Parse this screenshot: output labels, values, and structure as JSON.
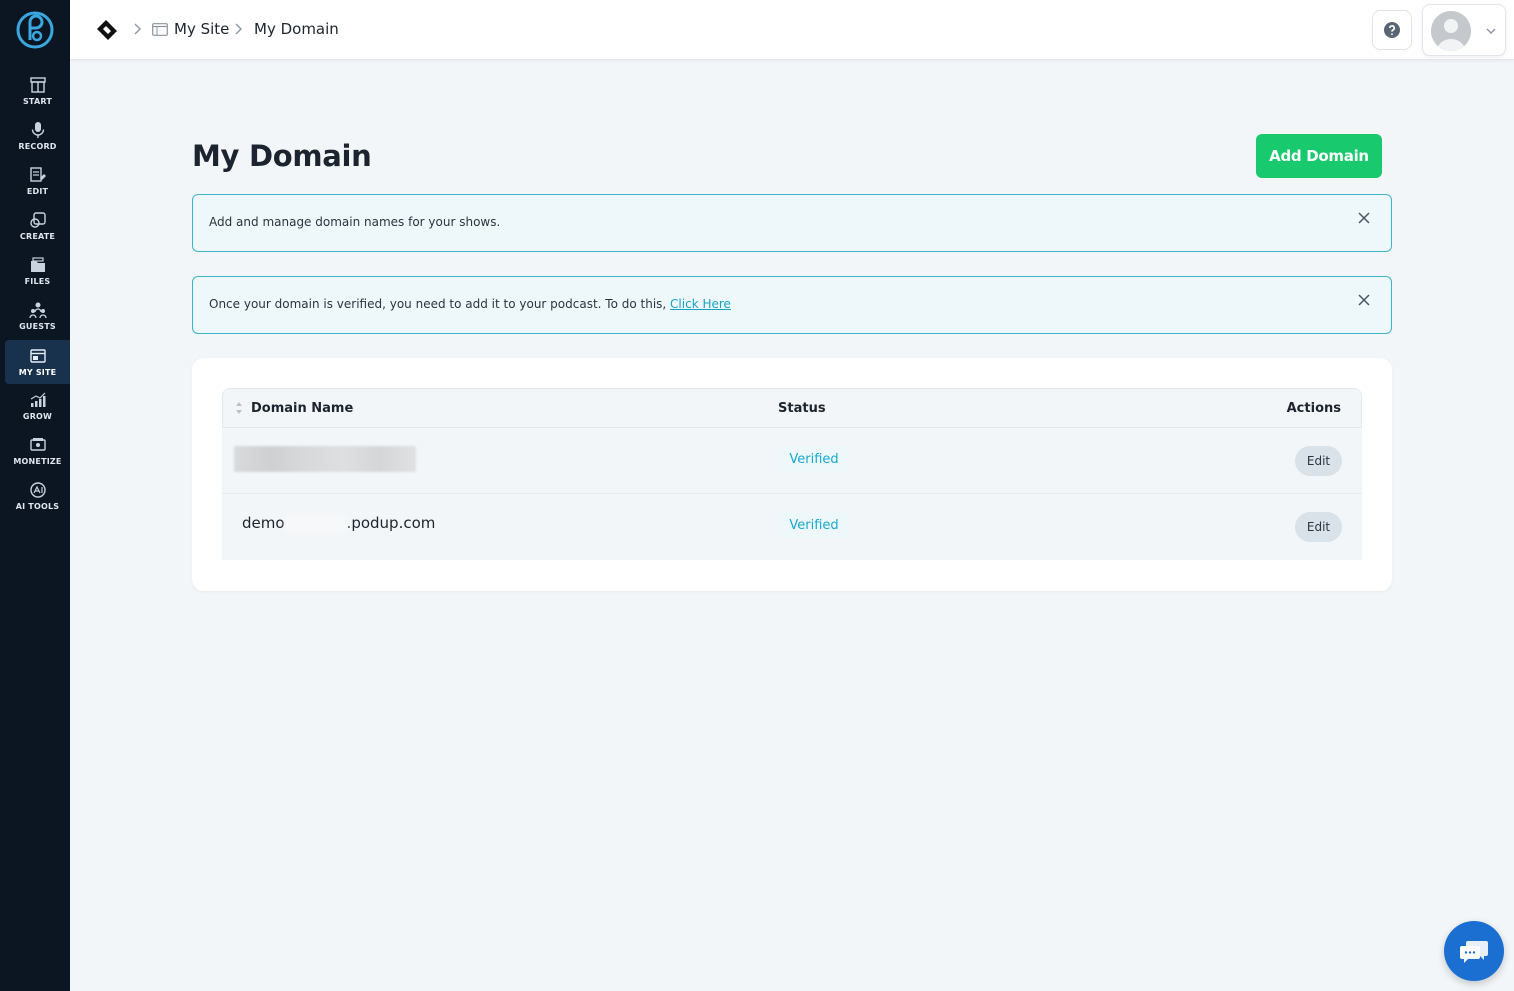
{
  "sidebar": {
    "items": [
      {
        "label": "START",
        "icon": "start-icon"
      },
      {
        "label": "RECORD",
        "icon": "microphone-icon"
      },
      {
        "label": "EDIT",
        "icon": "edit-icon"
      },
      {
        "label": "CREATE",
        "icon": "create-icon"
      },
      {
        "label": "FILES",
        "icon": "files-icon"
      },
      {
        "label": "GUESTS",
        "icon": "guests-icon"
      },
      {
        "label": "MY SITE",
        "icon": "my-site-icon",
        "active": true
      },
      {
        "label": "GROW",
        "icon": "grow-icon"
      },
      {
        "label": "MONETIZE",
        "icon": "monetize-icon"
      },
      {
        "label": "AI TOOLS",
        "icon": "ai-tools-icon"
      }
    ]
  },
  "header": {
    "breadcrumb": [
      {
        "label": "My Site"
      },
      {
        "label": "My Domain"
      }
    ]
  },
  "main": {
    "title": "My Domain",
    "add_button": "Add Domain",
    "notices": [
      {
        "text": "Add and manage domain names for your shows."
      },
      {
        "text": "Once your domain is verified, you need to add it to your podcast. To do this, ",
        "link": "Click Here"
      }
    ],
    "table": {
      "columns": [
        "Domain Name",
        "Status",
        "Actions"
      ],
      "rows": [
        {
          "domain": "",
          "status": "Verified",
          "action": "Edit"
        },
        {
          "domain_prefix": "demo",
          "domain_suffix": ".podup.com",
          "status": "Verified",
          "action": "Edit"
        }
      ]
    }
  },
  "colors": {
    "sidebar_bg": "#0b1622",
    "accent_green": "#19c96d",
    "notice_border": "#3fb3c9",
    "verified_text": "#17a9cf",
    "chat_blue": "#1a6fd1"
  }
}
